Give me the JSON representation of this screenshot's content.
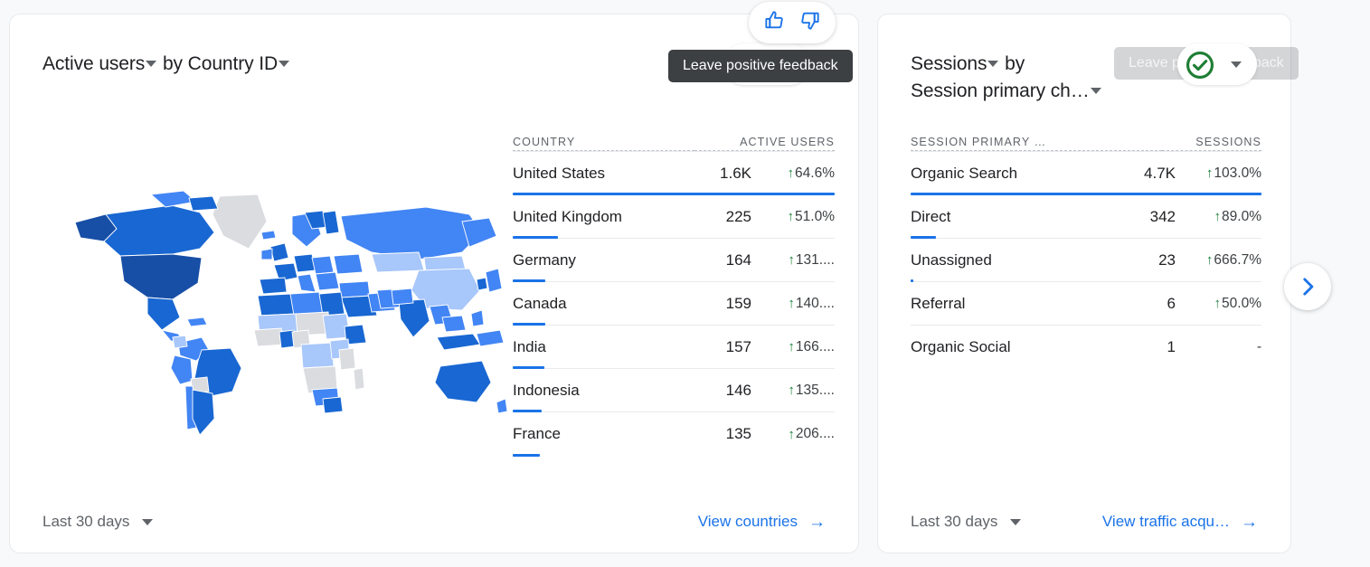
{
  "cards": [
    {
      "metric_label": "Active users",
      "by_label": "by",
      "dimension_label": "Country ID",
      "table": {
        "dimension_header": "COUNTRY",
        "metric_header": "ACTIVE USERS",
        "rows": [
          {
            "name": "United States",
            "value": "1.6K",
            "change": "64.6%",
            "direction": "up",
            "bar_pct": 100
          },
          {
            "name": "United Kingdom",
            "value": "225",
            "change": "51.0%",
            "direction": "up",
            "bar_pct": 14
          },
          {
            "name": "Germany",
            "value": "164",
            "change": "131....",
            "direction": "up",
            "bar_pct": 10
          },
          {
            "name": "Canada",
            "value": "159",
            "change": "140....",
            "direction": "up",
            "bar_pct": 10
          },
          {
            "name": "India",
            "value": "157",
            "change": "166....",
            "direction": "up",
            "bar_pct": 9.7
          },
          {
            "name": "Indonesia",
            "value": "146",
            "change": "135....",
            "direction": "up",
            "bar_pct": 9
          },
          {
            "name": "France",
            "value": "135",
            "change": "206....",
            "direction": "up",
            "bar_pct": 8.4
          }
        ]
      },
      "footer": {
        "date_range": "Last 30 days",
        "view_link": "View countries",
        "arrow": "→"
      }
    },
    {
      "metric_label": "Sessions",
      "by_label": "by",
      "dimension_label": "Session primary ch…",
      "table": {
        "dimension_header": "SESSION PRIMARY …",
        "metric_header": "SESSIONS",
        "rows": [
          {
            "name": "Organic Search",
            "value": "4.7K",
            "change": "103.0%",
            "direction": "up",
            "bar_pct": 100
          },
          {
            "name": "Direct",
            "value": "342",
            "change": "89.0%",
            "direction": "up",
            "bar_pct": 7.3
          },
          {
            "name": "Unassigned",
            "value": "23",
            "change": "666.7%",
            "direction": "up",
            "bar_pct": 0.5
          },
          {
            "name": "Referral",
            "value": "6",
            "change": "50.0%",
            "direction": "up",
            "bar_pct": 0
          },
          {
            "name": "Organic Social",
            "value": "1",
            "change": "-",
            "direction": "none",
            "bar_pct": 0
          }
        ]
      },
      "footer": {
        "date_range": "Last 30 days",
        "view_link": "View traffic acqu…",
        "arrow": "→"
      }
    }
  ],
  "feedback": {
    "thumbs_up_icon": "thumb-up-icon",
    "thumbs_down_icon": "thumb-down-icon",
    "tooltip_positive": "Leave positive feedback",
    "tooltip_positive_fading": "Leave positive feedback",
    "confirm_icon": "check-circle-icon"
  },
  "navigation": {
    "next_icon": "chevron-right-icon"
  },
  "colors": {
    "accent_blue": "#1a73e8",
    "positive_green": "#188038",
    "tooltip_bg": "#3c4043",
    "page_bg": "#f8f9fa",
    "card_border": "#e8eaed"
  },
  "map": {
    "title": "Active users by Country ID",
    "type": "choropleth",
    "legend_scale": [
      "#d9e7fb",
      "#a8c7fa",
      "#4285f4",
      "#1967d2",
      "#174ea6"
    ],
    "no_data_color": "#dadce0"
  }
}
